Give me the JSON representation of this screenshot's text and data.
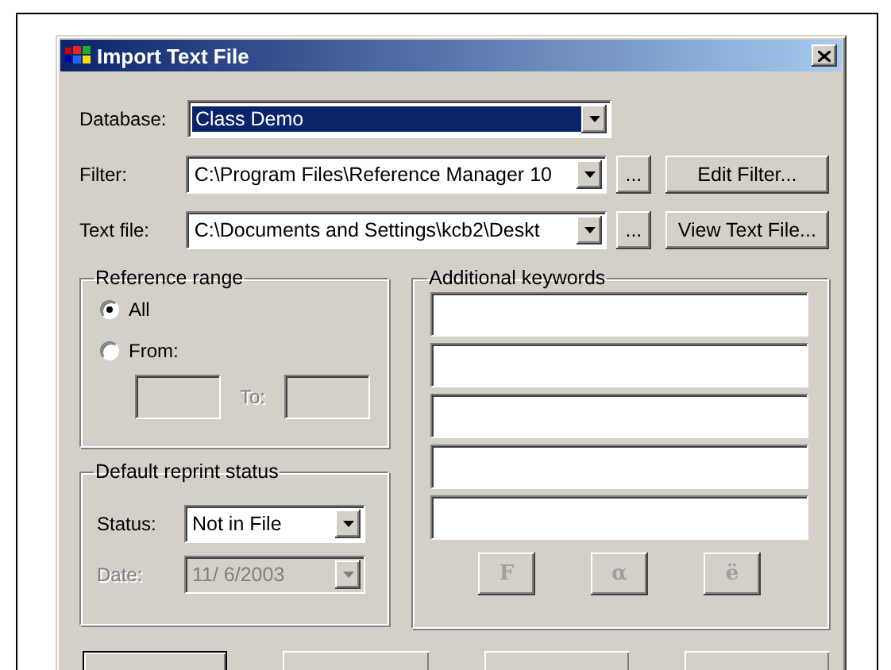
{
  "window": {
    "title": "Import Text File"
  },
  "database": {
    "label": "Database:",
    "value": "Class Demo",
    "highlighted": true
  },
  "filter": {
    "label": "Filter:",
    "value": "C:\\Program Files\\Reference Manager 10",
    "browse": "...",
    "button": "Edit Filter..."
  },
  "text_file": {
    "label": "Text file:",
    "value": "C:\\Documents and Settings\\kcb2\\Deskt",
    "browse": "...",
    "button": "View Text File..."
  },
  "reference_range": {
    "title": "Reference range",
    "options": [
      {
        "label": "All",
        "selected": true
      },
      {
        "label": "From:",
        "selected": false
      }
    ],
    "to_label": "To:",
    "fields_disabled": true
  },
  "reprint_status": {
    "title": "Default reprint status",
    "status": {
      "label": "Status:",
      "value": "Not in File"
    },
    "date": {
      "label": "Date:",
      "value": "11/ 6/2003",
      "disabled": true
    }
  },
  "keywords": {
    "title": "Additional keywords",
    "fields": [
      {
        "kind": "text"
      },
      {
        "kind": "text"
      },
      {
        "kind": "text"
      },
      {
        "kind": "text"
      },
      {
        "kind": "text"
      }
    ],
    "symbol_buttons": [
      {
        "label": "F",
        "disabled": true
      },
      {
        "label": "α",
        "disabled": true
      },
      {
        "label": "ë",
        "disabled": true
      }
    ]
  },
  "bottom_buttons": [
    {
      "default": true
    },
    {
      "default": false
    },
    {
      "default": false
    },
    {
      "default": false
    }
  ]
}
